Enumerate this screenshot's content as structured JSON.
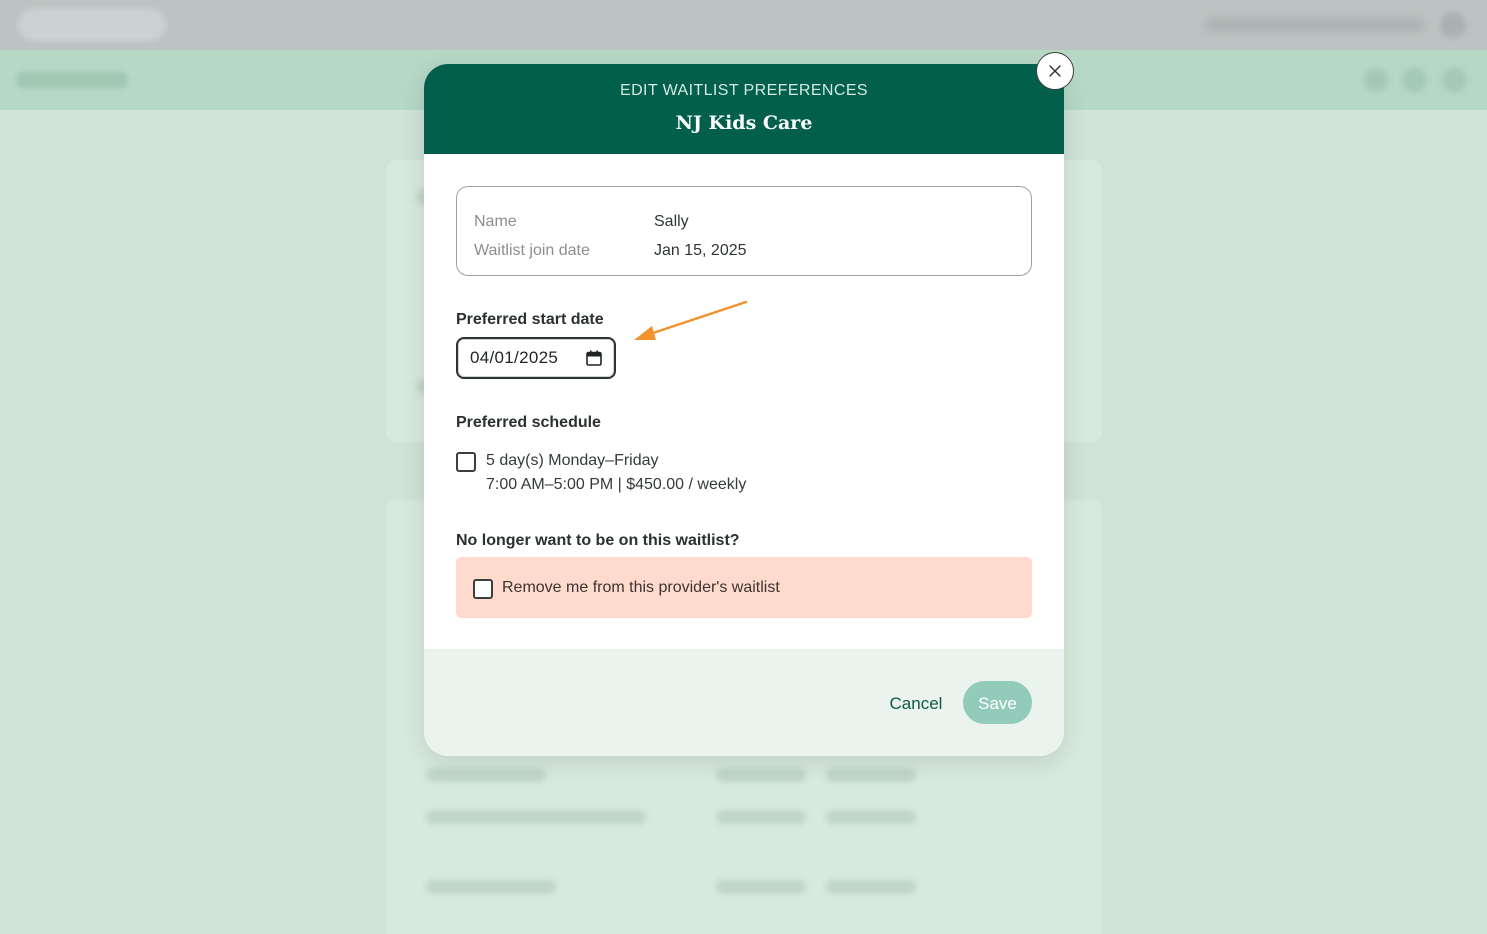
{
  "modal": {
    "eyebrow": "EDIT WAITLIST PREFERENCES",
    "title": "NJ Kids Care",
    "info": [
      {
        "label": "Name",
        "value": "Sally"
      },
      {
        "label": "Waitlist join date",
        "value": "Jan 15, 2025"
      }
    ],
    "start_date": {
      "label": "Preferred start date",
      "value": "04/01/2025"
    },
    "schedule": {
      "label": "Preferred schedule",
      "option_line1": "5 day(s) Monday–Friday",
      "option_line2": "7:00 AM–5:00 PM | $450.00 / weekly",
      "checked": false
    },
    "remove": {
      "label": "No longer want to be on this waitlist?",
      "checkbox_label": "Remove me from this provider's waitlist",
      "checked": false
    },
    "footer": {
      "cancel_label": "Cancel",
      "save_label": "Save"
    }
  },
  "colors": {
    "header_bg": "#015f4c",
    "annotation_arrow": "#f0922e",
    "save_disabled_bg": "#93cbbb",
    "remove_box_bg": "#ffdacd",
    "overlay_bg": "#cfe3d6"
  },
  "icons": {
    "close": "close-icon",
    "calendar": "calendar-icon",
    "annotation": "arrow-icon"
  }
}
